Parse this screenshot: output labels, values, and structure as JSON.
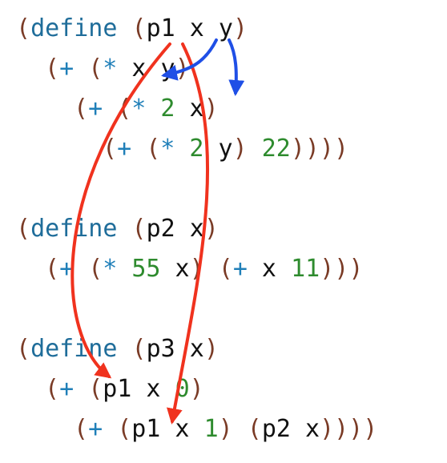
{
  "code_lines": [
    {
      "indent": 0,
      "tokens": [
        [
          "(",
          "paren"
        ],
        [
          "define",
          "kw"
        ],
        [
          " ",
          "id"
        ],
        [
          "(",
          "paren"
        ],
        [
          "p1",
          "id"
        ],
        [
          " x y",
          "id"
        ],
        [
          ")",
          "paren"
        ]
      ]
    },
    {
      "indent": 2,
      "tokens": [
        [
          "(",
          "paren"
        ],
        [
          "+",
          "op"
        ],
        [
          " ",
          "id"
        ],
        [
          "(",
          "paren"
        ],
        [
          "*",
          "op"
        ],
        [
          " x y",
          "id"
        ],
        [
          ")",
          "paren"
        ]
      ]
    },
    {
      "indent": 4,
      "tokens": [
        [
          "(",
          "paren"
        ],
        [
          "+",
          "op"
        ],
        [
          " ",
          "id"
        ],
        [
          "(",
          "paren"
        ],
        [
          "*",
          "op"
        ],
        [
          " ",
          "id"
        ],
        [
          "2",
          "num"
        ],
        [
          " x",
          "id"
        ],
        [
          ")",
          "paren"
        ]
      ]
    },
    {
      "indent": 6,
      "tokens": [
        [
          "(",
          "paren"
        ],
        [
          "+",
          "op"
        ],
        [
          " ",
          "id"
        ],
        [
          "(",
          "paren"
        ],
        [
          "*",
          "op"
        ],
        [
          " ",
          "id"
        ],
        [
          "2",
          "num"
        ],
        [
          " y",
          "id"
        ],
        [
          ")",
          "paren"
        ],
        [
          " ",
          "id"
        ],
        [
          "22",
          "num"
        ],
        [
          "))))",
          "paren"
        ]
      ]
    },
    {
      "indent": 0,
      "tokens": []
    },
    {
      "indent": 0,
      "tokens": [
        [
          "(",
          "paren"
        ],
        [
          "define",
          "kw"
        ],
        [
          " ",
          "id"
        ],
        [
          "(",
          "paren"
        ],
        [
          "p2",
          "id"
        ],
        [
          " x",
          "id"
        ],
        [
          ")",
          "paren"
        ]
      ]
    },
    {
      "indent": 2,
      "tokens": [
        [
          "(",
          "paren"
        ],
        [
          "+",
          "op"
        ],
        [
          " ",
          "id"
        ],
        [
          "(",
          "paren"
        ],
        [
          "*",
          "op"
        ],
        [
          " ",
          "id"
        ],
        [
          "55",
          "num"
        ],
        [
          " x",
          "id"
        ],
        [
          ")",
          "paren"
        ],
        [
          " ",
          "id"
        ],
        [
          "(",
          "paren"
        ],
        [
          "+",
          "op"
        ],
        [
          " x ",
          "id"
        ],
        [
          "11",
          "num"
        ],
        [
          "))",
          "paren"
        ],
        [
          ")",
          "paren"
        ]
      ]
    },
    {
      "indent": 0,
      "tokens": []
    },
    {
      "indent": 0,
      "tokens": [
        [
          "(",
          "paren"
        ],
        [
          "define",
          "kw"
        ],
        [
          " ",
          "id"
        ],
        [
          "(",
          "paren"
        ],
        [
          "p3",
          "id"
        ],
        [
          " x",
          "id"
        ],
        [
          ")",
          "paren"
        ]
      ]
    },
    {
      "indent": 2,
      "tokens": [
        [
          "(",
          "paren"
        ],
        [
          "+",
          "op"
        ],
        [
          " ",
          "id"
        ],
        [
          "(",
          "paren"
        ],
        [
          "p1",
          "id"
        ],
        [
          " x ",
          "id"
        ],
        [
          "0",
          "num"
        ],
        [
          ")",
          "paren"
        ]
      ]
    },
    {
      "indent": 4,
      "tokens": [
        [
          "(",
          "paren"
        ],
        [
          "+",
          "op"
        ],
        [
          " ",
          "id"
        ],
        [
          "(",
          "paren"
        ],
        [
          "p1",
          "id"
        ],
        [
          " x ",
          "id"
        ],
        [
          "1",
          "num"
        ],
        [
          ")",
          "paren"
        ],
        [
          " ",
          "id"
        ],
        [
          "(",
          "paren"
        ],
        [
          "p2",
          "id"
        ],
        [
          " x",
          "id"
        ],
        [
          ")))",
          "paren"
        ],
        [
          ")",
          "paren"
        ]
      ]
    }
  ],
  "colors": {
    "paren": "#7a3b26",
    "keyword": "#1f6d9a",
    "operator": "#1f7fb8",
    "identifier": "#111111",
    "number": "#2e8b2e",
    "arrow_red": "#f0321e",
    "arrow_blue": "#1f4fe6"
  },
  "arrows": [
    {
      "name": "p1-def-to-p3-call-1",
      "color": "red",
      "from": "p1 definition",
      "to": "first p1 call in p3"
    },
    {
      "name": "p1-def-to-p3-call-2",
      "color": "red",
      "from": "p1 definition",
      "to": "second p1 call in p3"
    },
    {
      "name": "x-param-to-x-use",
      "color": "blue",
      "from": "parameter x",
      "to": "x in (* x y)"
    },
    {
      "name": "y-param-to-x-use",
      "color": "blue",
      "from": "parameter y",
      "to": "x in (* 2 x)"
    }
  ]
}
